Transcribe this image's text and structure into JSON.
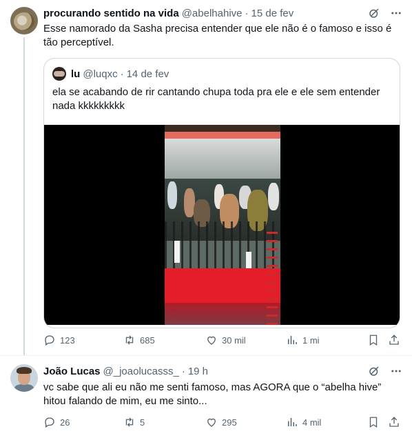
{
  "tweet1": {
    "name": "procurando sentido na vida",
    "handle": "@abelhahive",
    "separator": "·",
    "date": "15 de fev",
    "text": "Esse namorado da Sasha precisa entender que ele não é o famoso e isso é tão perceptível.",
    "icons": [
      "grok-icon",
      "more-icon"
    ],
    "quote": {
      "name": "lu",
      "handle": "@luqxc",
      "separator": "·",
      "date": "14 de fev",
      "text": "ela se acabando de rir cantando chupa toda pra ele e ele sem entender nada kkkkkkkkk"
    },
    "stats": {
      "replies": "123",
      "reposts": "685",
      "likes": "30 mil",
      "views": "1 mi"
    }
  },
  "tweet2": {
    "name": "João Lucas",
    "handle": "@_joaolucasss_",
    "separator": "·",
    "date": "19 h",
    "text": "vc sabe que ali eu não me senti famoso, mas AGORA que o “abelha hive” hitou falando de mim, eu me sinto...",
    "icons": [
      "grok-icon",
      "more-icon"
    ],
    "stats": {
      "replies": "26",
      "reposts": "5",
      "likes": "295",
      "views": "4 mil"
    }
  },
  "colors": {
    "text": "#0f1419",
    "secondary": "#536471",
    "border": "#cfd9de",
    "thread_line": "#cfd9de"
  }
}
